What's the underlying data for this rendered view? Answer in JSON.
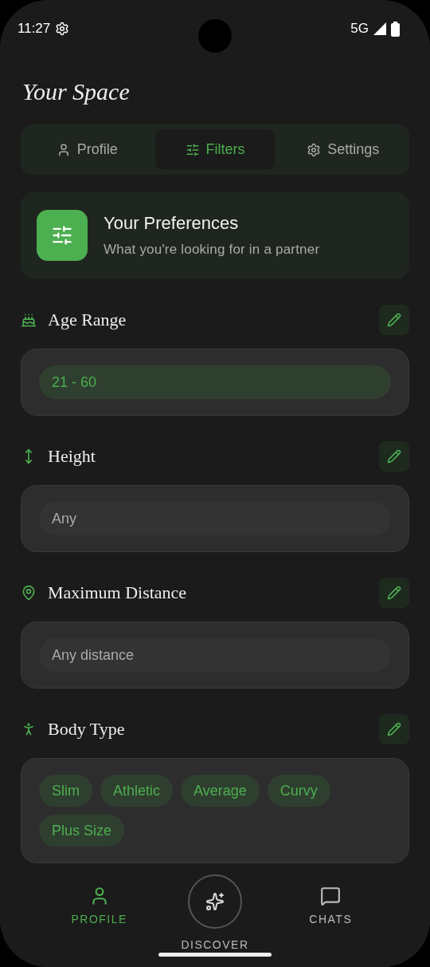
{
  "status_bar": {
    "time": "11:27",
    "network": "5G"
  },
  "title": "Your Space",
  "tabs": [
    {
      "label": "Profile",
      "kind": "person",
      "selected": false
    },
    {
      "label": "Filters",
      "kind": "sliders",
      "selected": true
    },
    {
      "label": "Settings",
      "kind": "gear",
      "selected": false
    }
  ],
  "header_card": {
    "title": "Your Preferences",
    "subtitle": "What you're looking for in a partner"
  },
  "sections": [
    {
      "title": "Age Range",
      "kind": "age",
      "value": {
        "text": "21 - 60",
        "selected": true
      }
    },
    {
      "title": "Height",
      "kind": "height",
      "value": {
        "text": "Any",
        "selected": false
      }
    },
    {
      "title": "Maximum Distance",
      "kind": "distance",
      "value": {
        "text": "Any distance",
        "selected": false
      }
    },
    {
      "title": "Body Type",
      "kind": "body",
      "chips": [
        {
          "label": "Slim",
          "selected": true
        },
        {
          "label": "Athletic",
          "selected": true
        },
        {
          "label": "Average",
          "selected": true
        },
        {
          "label": "Curvy",
          "selected": true
        },
        {
          "label": "Plus Size",
          "selected": true
        }
      ]
    }
  ],
  "nav": [
    {
      "label": "PROFILE",
      "kind": "person",
      "selected": true
    },
    {
      "label": "DISCOVER",
      "kind": "discover",
      "selected": false
    },
    {
      "label": "CHATS",
      "kind": "chat",
      "selected": false
    }
  ]
}
